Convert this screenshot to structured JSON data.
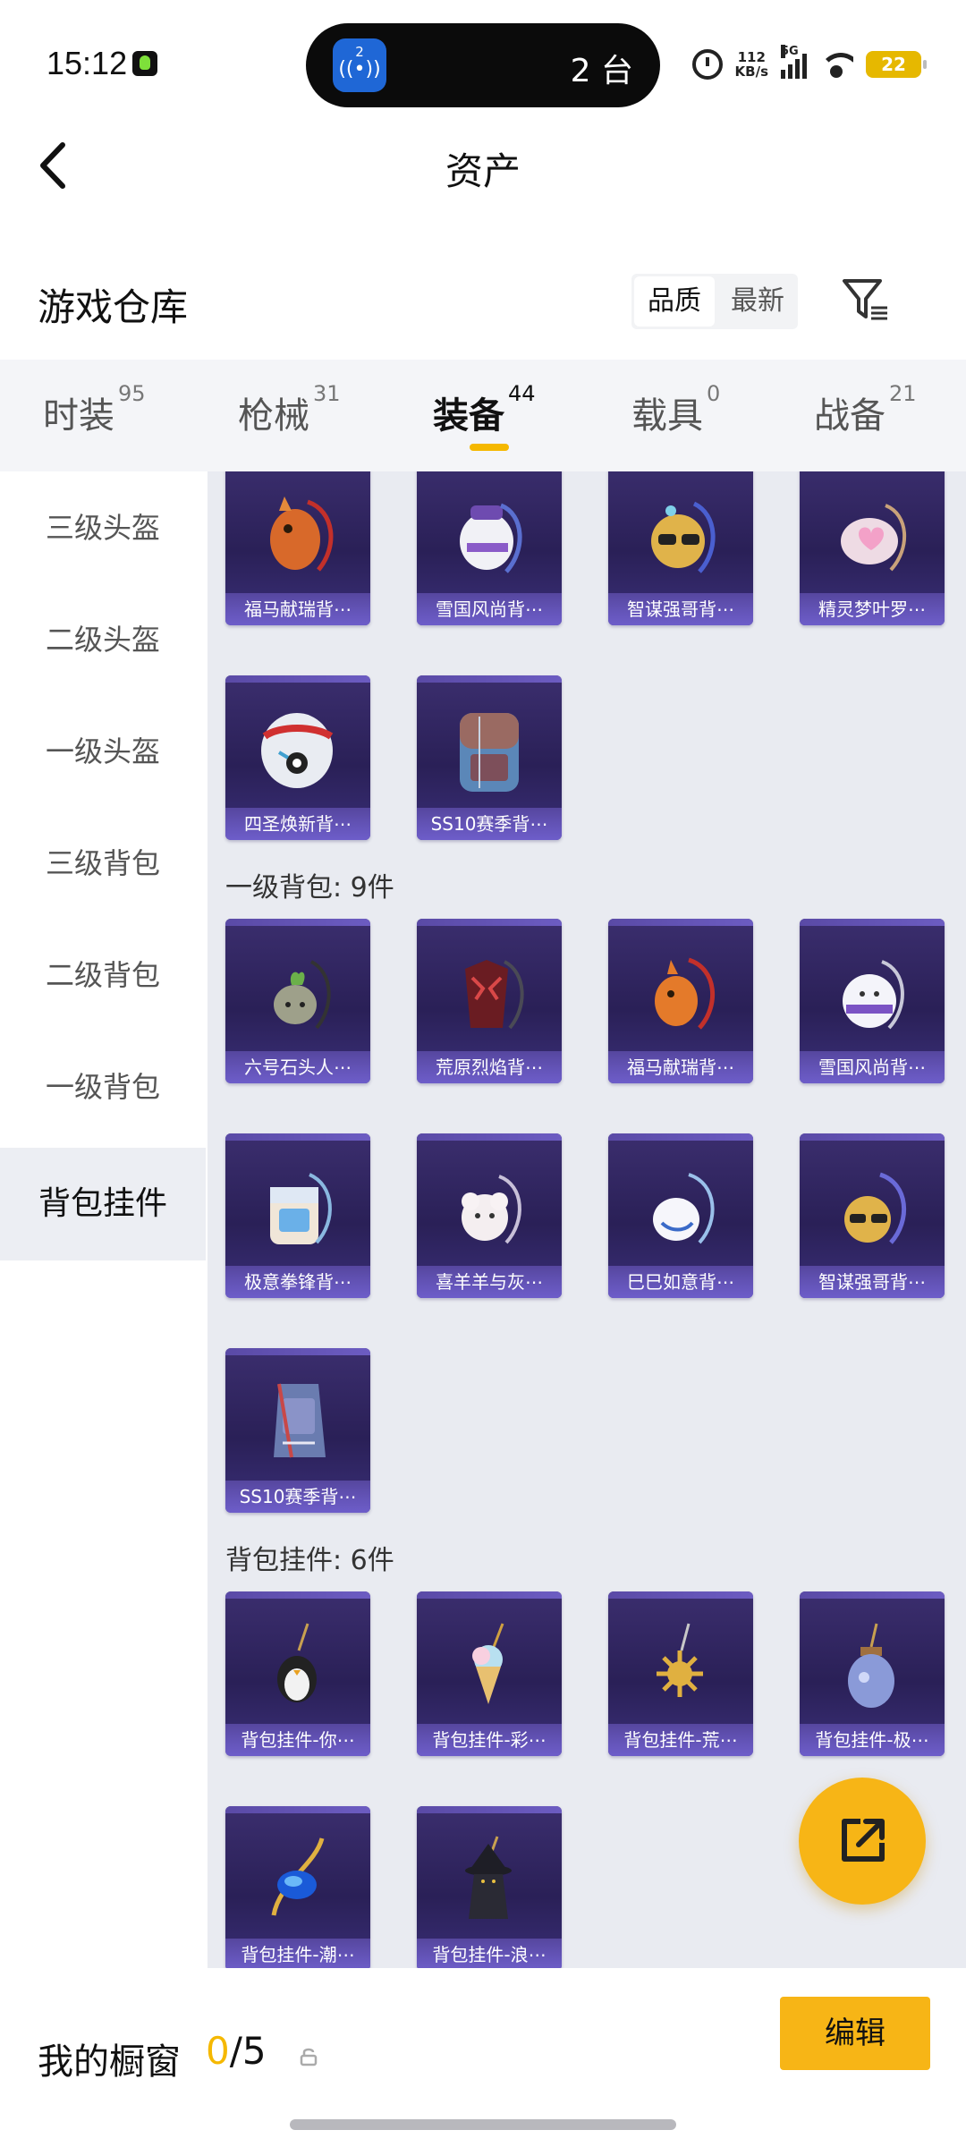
{
  "status_bar": {
    "time": "15:12",
    "island_badge_num": "2",
    "island_count": "2 台",
    "net_speed_value": "112",
    "net_speed_unit": "KB/s",
    "signal_label": "5G",
    "battery": "22"
  },
  "header": {
    "title": "资产"
  },
  "warehouse": {
    "title": "游戏仓库",
    "sort_options": [
      "品质",
      "最新"
    ],
    "active_sort": "品质"
  },
  "tabs": [
    {
      "label": "时装",
      "count": "95"
    },
    {
      "label": "枪械",
      "count": "31"
    },
    {
      "label": "装备",
      "count": "44",
      "active": true
    },
    {
      "label": "载具",
      "count": "0"
    },
    {
      "label": "战备",
      "count": "21"
    }
  ],
  "sidenav": [
    "三级头盔",
    "二级头盔",
    "一级头盔",
    "三级背包",
    "二级背包",
    "一级背包",
    "背包挂件"
  ],
  "sidenav_active": "背包挂件",
  "sections": [
    {
      "title": "",
      "items": [
        "福马献瑞背⋯",
        "雪国风尚背⋯",
        "智谋强哥背⋯",
        "精灵梦叶罗⋯",
        "四圣焕新背⋯",
        "SS10赛季背⋯"
      ]
    },
    {
      "title": "一级背包: 9件",
      "items": [
        "六号石头人⋯",
        "荒原烈焰背⋯",
        "福马献瑞背⋯",
        "雪国风尚背⋯",
        "极意拳锋背⋯",
        "喜羊羊与灰⋯",
        "巳巳如意背⋯",
        "智谋强哥背⋯",
        "SS10赛季背⋯"
      ]
    },
    {
      "title": "背包挂件: 6件",
      "items": [
        "背包挂件-你⋯",
        "背包挂件-彩⋯",
        "背包挂件-荒⋯",
        "背包挂件-极⋯",
        "背包挂件-潮⋯",
        "背包挂件-浪⋯"
      ]
    }
  ],
  "bottom": {
    "label": "我的橱窗",
    "current": "0",
    "total": "/5",
    "edit_label": "编辑"
  },
  "colors": {
    "accent": "#f7b516",
    "card_bg": "#2a2057",
    "label_bg": "#6d5dc9"
  }
}
